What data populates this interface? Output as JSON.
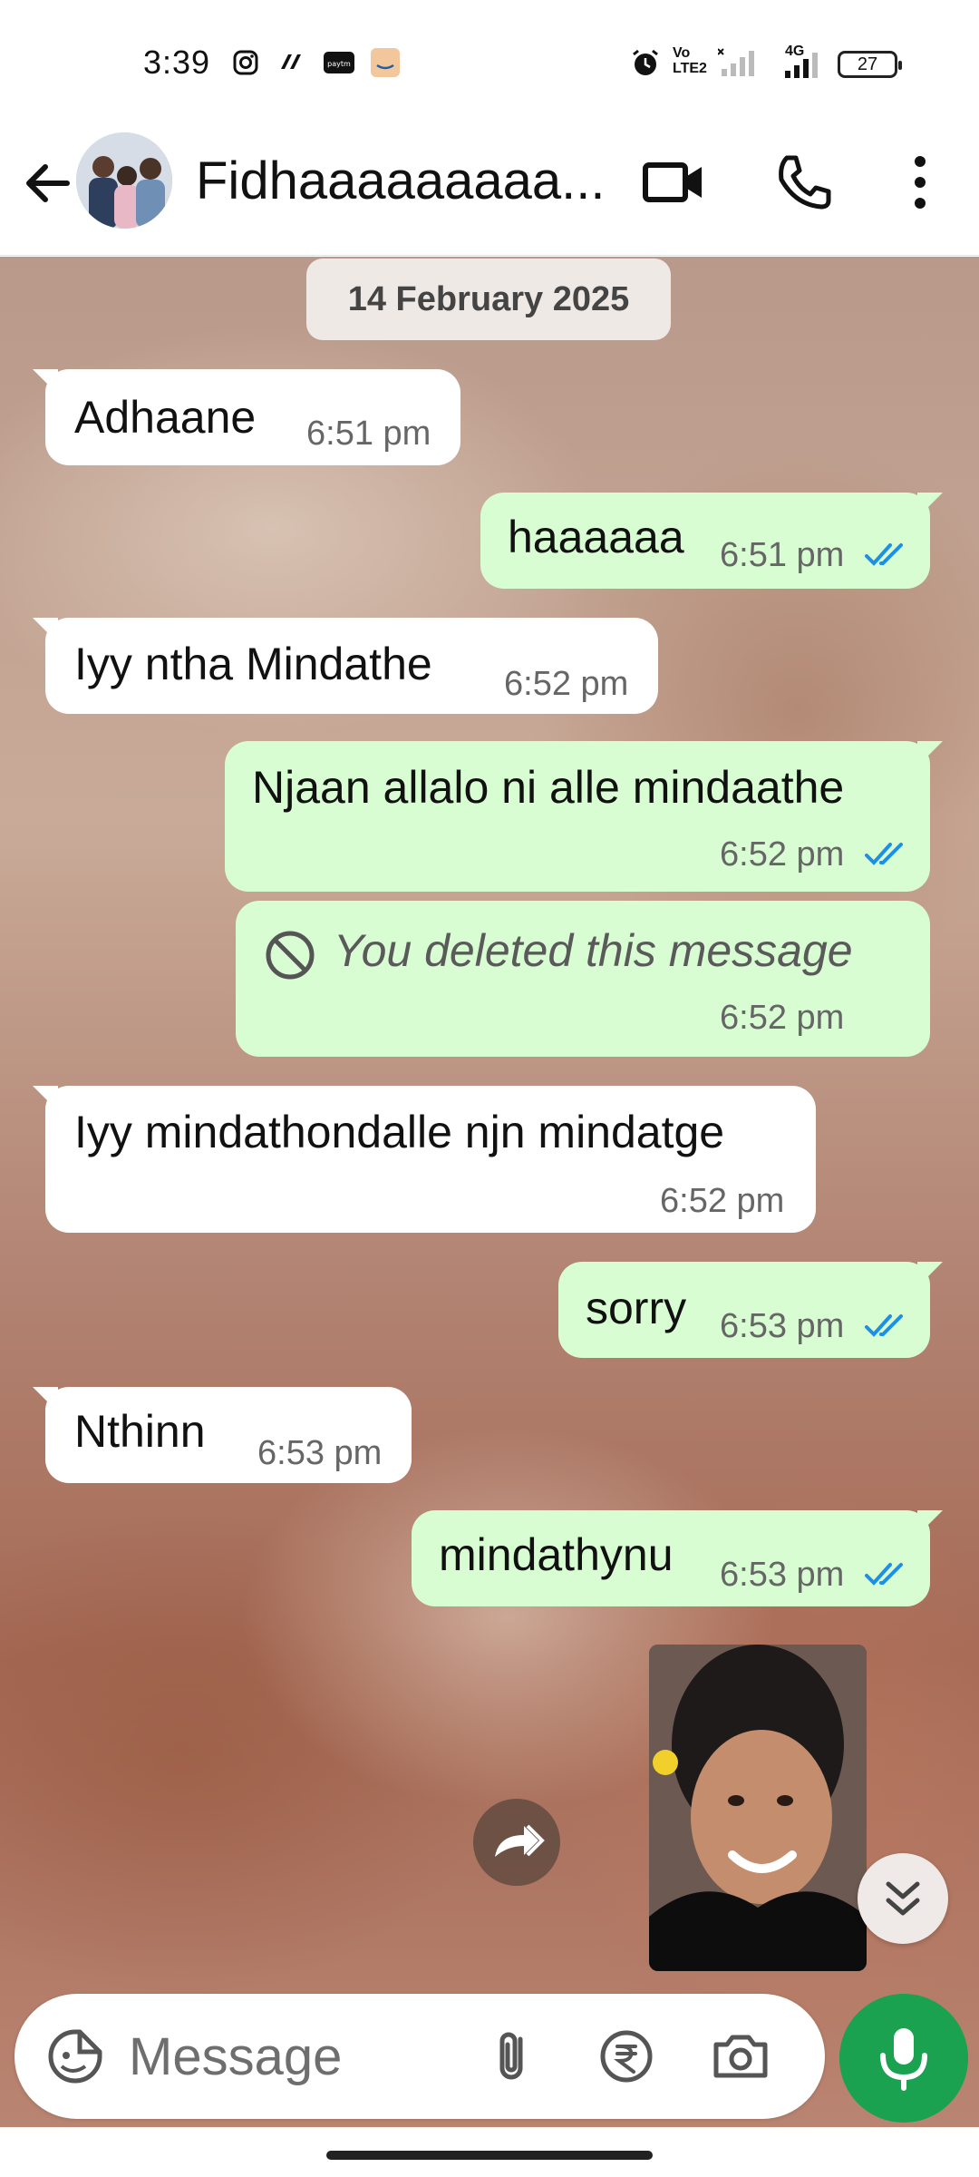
{
  "status_bar": {
    "time": "3:39",
    "battery": "27",
    "icons": [
      "instagram-icon",
      "app-icon",
      "paytm-icon",
      "amazon-icon",
      "alarm-icon",
      "volte-icon",
      "signal-icon",
      "4g-signal-icon",
      "battery-icon"
    ],
    "volte_label": "Vo LTE2",
    "network_label": "4G"
  },
  "header": {
    "contact_name": "Fidhaaaaaaaaa...",
    "icons": [
      "back-arrow-icon",
      "video-call-icon",
      "phone-icon",
      "more-vert-icon"
    ]
  },
  "chat": {
    "date_chip": "14 February 2025",
    "messages": [
      {
        "dir": "in",
        "text": "Adhaane",
        "time": "6:51 pm"
      },
      {
        "dir": "out",
        "text": "haaaaaa",
        "time": "6:51 pm",
        "read": true
      },
      {
        "dir": "in",
        "text": "Iyy ntha Mindathe",
        "time": "6:52 pm"
      },
      {
        "dir": "out",
        "text": "Njaan allalo ni alle mindaathe",
        "time": "6:52 pm",
        "read": true
      },
      {
        "dir": "out",
        "text": "You deleted this message",
        "time": "6:52 pm",
        "deleted": true
      },
      {
        "dir": "in",
        "text": "Iyy mindathondalle njn mindatge",
        "time": "6:52 pm"
      },
      {
        "dir": "out",
        "text": "sorry",
        "time": "6:53 pm",
        "read": true
      },
      {
        "dir": "in",
        "text": "Nthinn",
        "time": "6:53 pm"
      },
      {
        "dir": "out",
        "text": "mindathynu",
        "time": "6:53 pm",
        "read": true
      }
    ]
  },
  "composer": {
    "placeholder": "Message",
    "icons": [
      "sticker-icon",
      "attach-icon",
      "rupee-payment-icon",
      "camera-icon",
      "mic-icon"
    ]
  },
  "colors": {
    "outgoing_bubble": "#d8fdd2",
    "incoming_bubble": "#ffffff",
    "read_ticks": "#1d8fe8",
    "mic_button": "#1aa250"
  }
}
